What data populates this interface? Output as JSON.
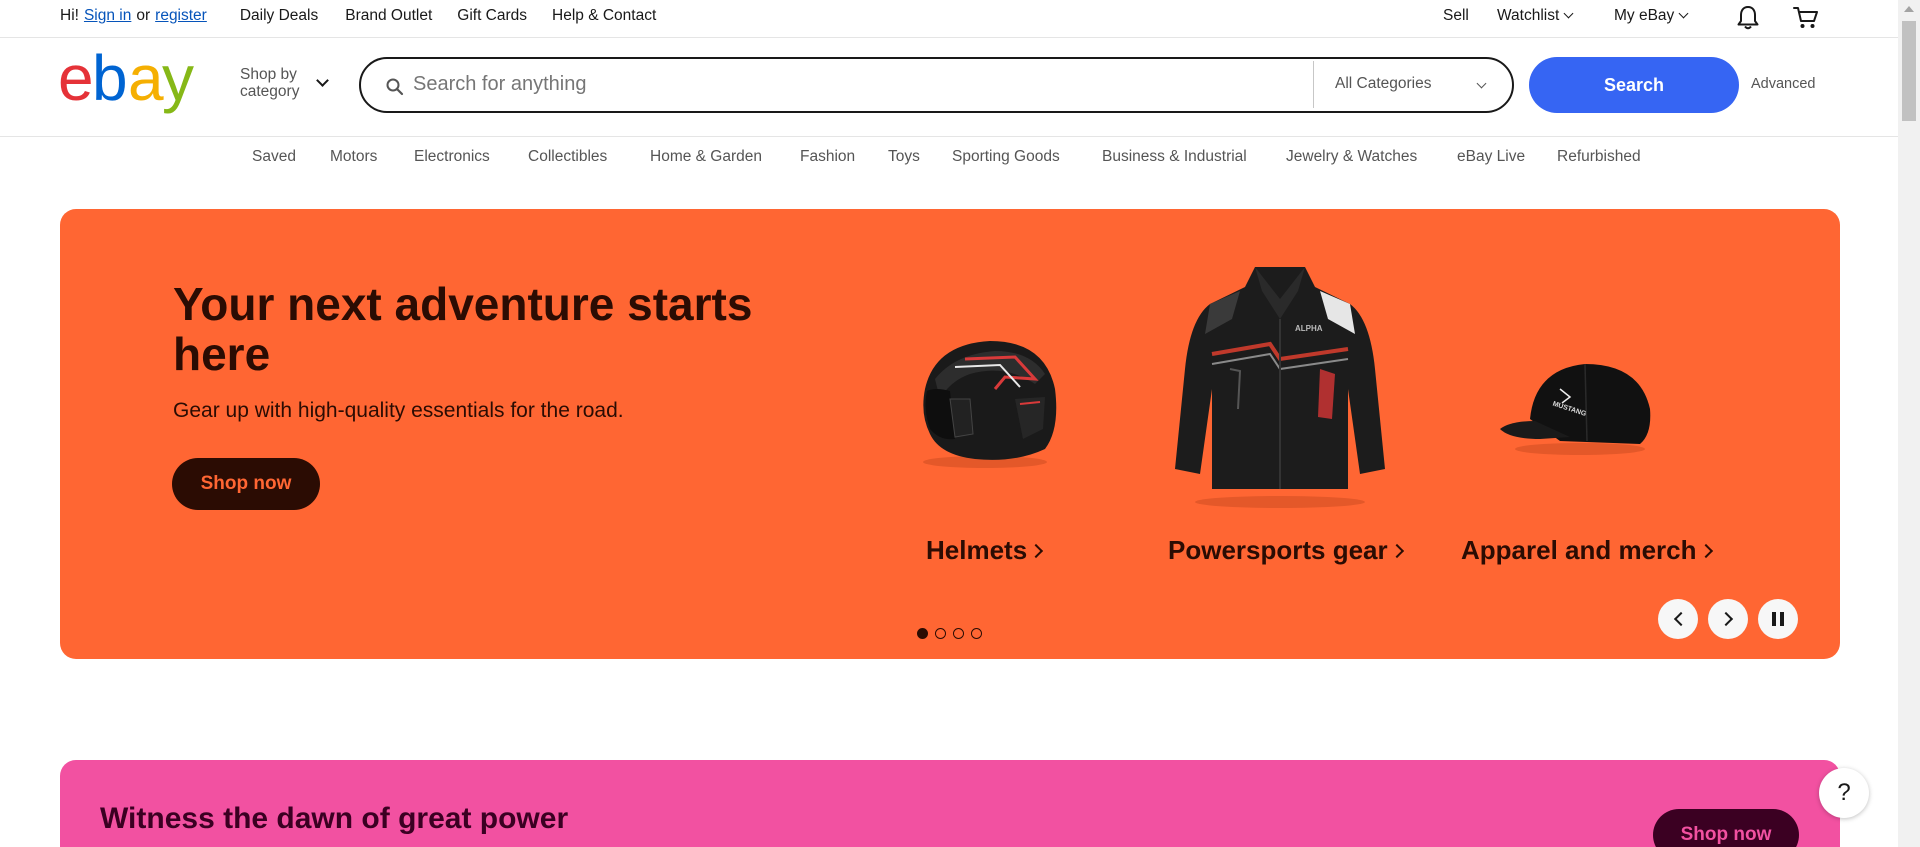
{
  "topbar": {
    "greeting": "Hi!",
    "sign_in": "Sign in",
    "or": "or",
    "register": "register",
    "links": [
      "Daily Deals",
      "Brand Outlet",
      "Gift Cards",
      "Help & Contact"
    ],
    "sell": "Sell",
    "watchlist": "Watchlist",
    "my_ebay": "My eBay",
    "icons": {
      "notifications": "bell-icon",
      "cart": "cart-icon"
    }
  },
  "header": {
    "logo_letters": [
      "e",
      "b",
      "a",
      "y"
    ],
    "logo_colors": [
      "#e53238",
      "#0064d2",
      "#f5af02",
      "#86b817"
    ],
    "shop_by_category": [
      "Shop by",
      "category"
    ],
    "search_placeholder": "Search for anything",
    "search_value": "",
    "category_selected": "All Categories",
    "search_button": "Search",
    "advanced": "Advanced"
  },
  "category_nav": [
    "Saved",
    "Motors",
    "Electronics",
    "Collectibles",
    "Home & Garden",
    "Fashion",
    "Toys",
    "Sporting Goods",
    "Business & Industrial",
    "Jewelry & Watches",
    "eBay Live",
    "Refurbished"
  ],
  "hero": {
    "title": "Your next adventure starts here",
    "subtitle": "Gear up with high-quality essentials for the road.",
    "cta": "Shop now",
    "bg_color": "#ff6633",
    "text_color": "#2b0c03",
    "products": [
      {
        "label": "Helmets",
        "image": "motorcycle-helmet"
      },
      {
        "label": "Powersports gear",
        "image": "riding-jacket"
      },
      {
        "label": "Apparel and merch",
        "image": "baseball-cap"
      }
    ],
    "jacket_brand": "ALPHA",
    "cap_text": "MUSTANG",
    "carousel_slides": 4,
    "carousel_active": 1
  },
  "banner2": {
    "title": "Witness the dawn of great power",
    "cta": "Shop now",
    "bg_color": "#f251a1"
  },
  "help_label": "?",
  "accent_color": "#3665f3"
}
